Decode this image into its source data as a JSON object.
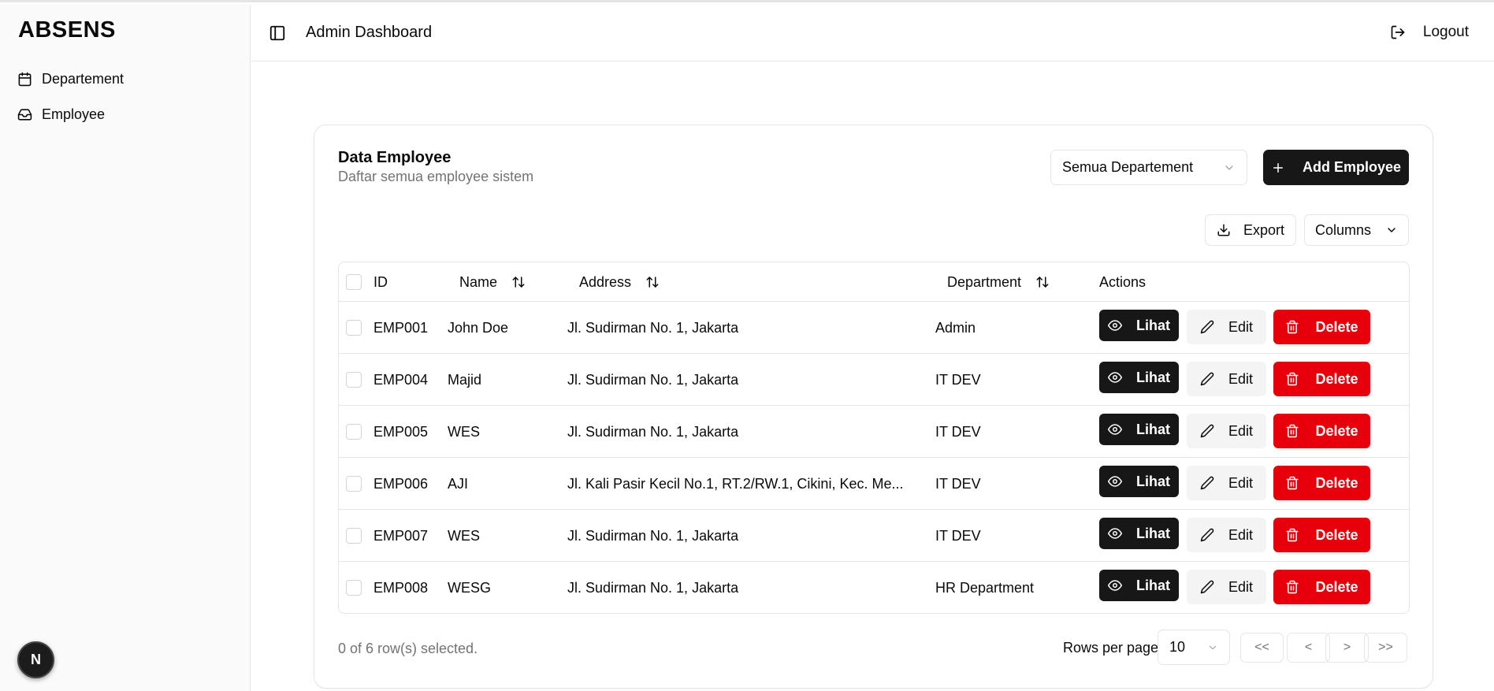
{
  "sidebar": {
    "brand": "ABSENS",
    "items": [
      {
        "label": "Departement",
        "icon": "calendar-icon"
      },
      {
        "label": "Employee",
        "icon": "inbox-icon"
      }
    ],
    "badge": "N"
  },
  "header": {
    "title": "Admin Dashboard",
    "logout_label": "Logout"
  },
  "card": {
    "title": "Data Employee",
    "subtitle": "Daftar semua employee sistem",
    "department_filter": "Semua Departement",
    "add_label": "Add Employee",
    "export_label": "Export",
    "columns_label": "Columns"
  },
  "table": {
    "columns": [
      "ID",
      "Name",
      "Address",
      "Department",
      "Actions"
    ],
    "rows": [
      {
        "id": "EMP001",
        "name": "John Doe",
        "address": "Jl. Sudirman No. 1, Jakarta",
        "department": "Admin"
      },
      {
        "id": "EMP004",
        "name": "Majid",
        "address": "Jl. Sudirman No. 1, Jakarta",
        "department": "IT DEV"
      },
      {
        "id": "EMP005",
        "name": "WES",
        "address": "Jl. Sudirman No. 1, Jakarta",
        "department": "IT DEV"
      },
      {
        "id": "EMP006",
        "name": "AJI",
        "address": "Jl. Kali Pasir Kecil No.1, RT.2/RW.1, Cikini, Kec. Me...",
        "department": "IT DEV"
      },
      {
        "id": "EMP007",
        "name": "WES",
        "address": "Jl. Sudirman No. 1, Jakarta",
        "department": "IT DEV"
      },
      {
        "id": "EMP008",
        "name": "WESG",
        "address": "Jl. Sudirman No. 1, Jakarta",
        "department": "HR Department"
      }
    ],
    "actions": {
      "view": "Lihat",
      "edit": "Edit",
      "delete": "Delete"
    }
  },
  "footer": {
    "selection": "0 of 6 row(s) selected.",
    "rows_per_page_label": "Rows per page",
    "rows_per_page": "10",
    "pagination": [
      "<<",
      "<",
      ">",
      ">>"
    ]
  },
  "colors": {
    "primary": "#171717",
    "danger": "#e7000b",
    "muted": "#737373",
    "border": "#e5e5e5"
  }
}
